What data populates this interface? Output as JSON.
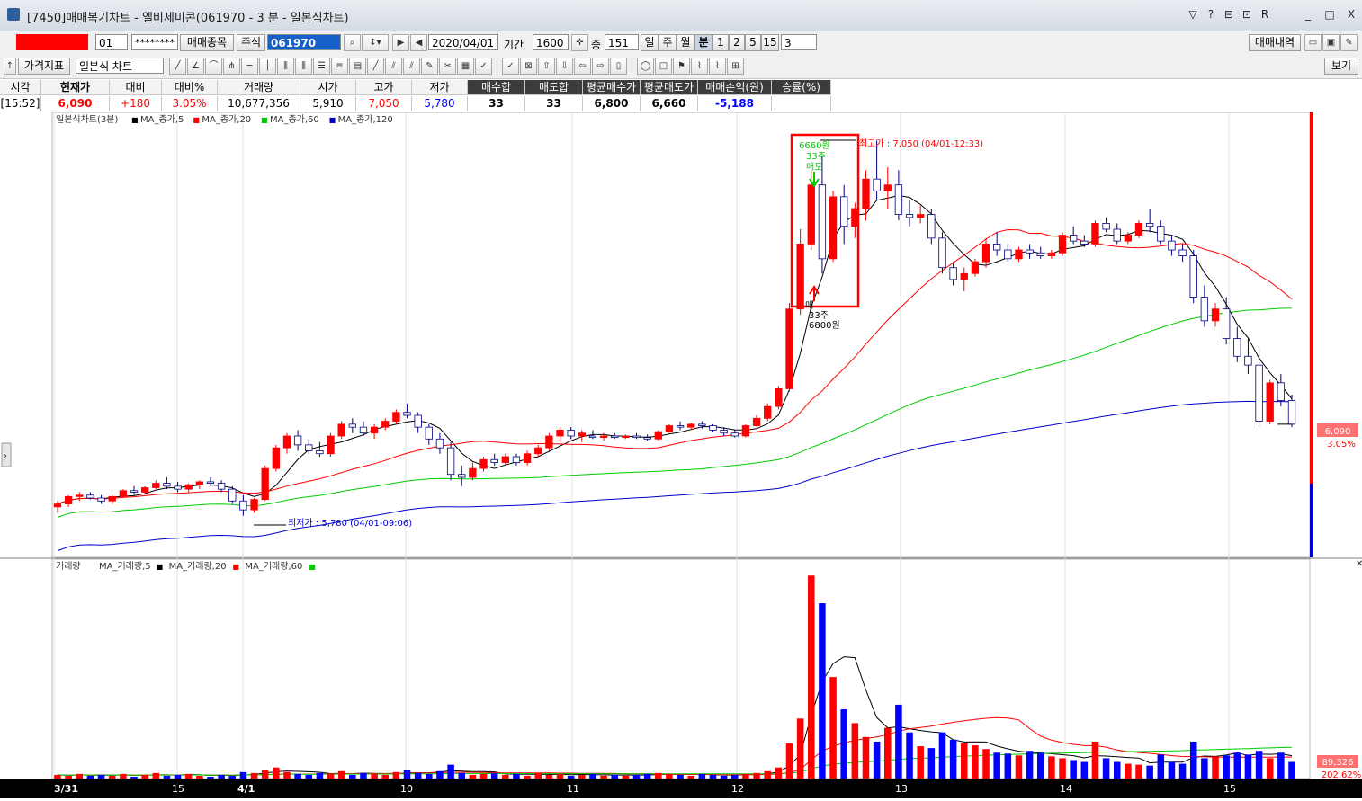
{
  "window": {
    "title": "[7450]매매복기차트 - 엘비세미콘(061970 - 3 분 - 일본식차트)",
    "controls": [
      "▽",
      "?",
      "⊟",
      "⊡",
      "R",
      "_",
      "□",
      "X"
    ]
  },
  "toolbar1": {
    "account_suffix": "01",
    "password": "********",
    "trade_items_btn": "매매종목",
    "market": "주식",
    "code": "061970",
    "date": "2020/04/01",
    "period_label": "기간",
    "period_value": "1600",
    "mid_label": "중",
    "count_value": "151",
    "units": [
      "일",
      "주",
      "월",
      "분",
      "1",
      "2",
      "5",
      "15",
      "3"
    ],
    "trade_history_btn": "매매내역"
  },
  "toolbar2": {
    "indicator_btn": "가격지표",
    "chart_type": "일본식 차트",
    "view_btn": "보기"
  },
  "quote": {
    "headers": [
      "시각",
      "현재가",
      "대비",
      "대비%",
      "거래량",
      "시가",
      "고가",
      "저가",
      "매수합",
      "매도합",
      "평균매수가",
      "평균매도가",
      "매매손익(원)",
      "승률(%)"
    ],
    "values": [
      "[15:52]",
      "6,090",
      "+180",
      "3.05%",
      "10,677,356",
      "5,910",
      "7,050",
      "5,780",
      "33",
      "33",
      "6,800",
      "6,660",
      "-5,188",
      ""
    ]
  },
  "chart_data": {
    "type": "candlestick",
    "price_legend": {
      "title": "일본식차트(3분)",
      "ma": [
        {
          "name": "MA_종가,5",
          "color": "#000000"
        },
        {
          "name": "MA_종가,20",
          "color": "#ff0000"
        },
        {
          "name": "MA_종가,60",
          "color": "#00cc00"
        },
        {
          "name": "MA_종가,120",
          "color": "#0000cc"
        }
      ]
    },
    "volume_legend": {
      "title": "거래량",
      "ma": [
        {
          "name": "MA_거래량,5",
          "color": "#000000"
        },
        {
          "name": "MA_거래량,20",
          "color": "#ff0000"
        },
        {
          "name": "MA_거래량,60",
          "color": "#00cc00"
        }
      ]
    },
    "x_ticks": [
      "3/31",
      "15",
      "4/1",
      "10",
      "11",
      "12",
      "13",
      "14",
      "15"
    ],
    "annotations": {
      "high": "최고가 : 7,050 (04/01-12:33)",
      "low": "최저가 : 5,780 (04/01-09:06)",
      "sell": [
        "6660원",
        "33주",
        "매도"
      ],
      "buy": [
        "매",
        "33주",
        "6800원"
      ]
    },
    "current_price": "6,090",
    "current_change": "3.05%",
    "volume_right_value": "89,326",
    "volume_right_pct": "202.62%",
    "y_range_price": [
      5700,
      7100
    ],
    "candles": [
      [
        5810,
        5830,
        5790,
        5820
      ],
      [
        5820,
        5850,
        5810,
        5845
      ],
      [
        5845,
        5860,
        5830,
        5850
      ],
      [
        5850,
        5860,
        5835,
        5840
      ],
      [
        5840,
        5850,
        5820,
        5830
      ],
      [
        5830,
        5850,
        5820,
        5845
      ],
      [
        5845,
        5870,
        5840,
        5865
      ],
      [
        5865,
        5880,
        5850,
        5860
      ],
      [
        5860,
        5880,
        5855,
        5875
      ],
      [
        5875,
        5900,
        5870,
        5890
      ],
      [
        5890,
        5910,
        5870,
        5880
      ],
      [
        5880,
        5895,
        5860,
        5870
      ],
      [
        5870,
        5890,
        5860,
        5885
      ],
      [
        5885,
        5900,
        5870,
        5895
      ],
      [
        5895,
        5910,
        5880,
        5890
      ],
      [
        5890,
        5900,
        5860,
        5870
      ],
      [
        5870,
        5880,
        5820,
        5830
      ],
      [
        5830,
        5850,
        5780,
        5800
      ],
      [
        5800,
        5840,
        5790,
        5835
      ],
      [
        5835,
        5950,
        5830,
        5940
      ],
      [
        5940,
        6020,
        5930,
        6010
      ],
      [
        6010,
        6060,
        5990,
        6050
      ],
      [
        6050,
        6070,
        6000,
        6020
      ],
      [
        6020,
        6040,
        5990,
        6000
      ],
      [
        6000,
        6030,
        5980,
        5990
      ],
      [
        5990,
        6060,
        5980,
        6050
      ],
      [
        6050,
        6100,
        6040,
        6090
      ],
      [
        6090,
        6110,
        6060,
        6080
      ],
      [
        6080,
        6100,
        6050,
        6060
      ],
      [
        6060,
        6090,
        6040,
        6080
      ],
      [
        6080,
        6110,
        6070,
        6100
      ],
      [
        6100,
        6140,
        6090,
        6130
      ],
      [
        6130,
        6160,
        6110,
        6120
      ],
      [
        6120,
        6130,
        6060,
        6080
      ],
      [
        6080,
        6090,
        6020,
        6040
      ],
      [
        6040,
        6060,
        5990,
        6010
      ],
      [
        6010,
        6030,
        5900,
        5920
      ],
      [
        5920,
        5950,
        5880,
        5910
      ],
      [
        5910,
        5960,
        5900,
        5940
      ],
      [
        5940,
        5980,
        5930,
        5970
      ],
      [
        5970,
        5990,
        5950,
        5960
      ],
      [
        5960,
        5990,
        5950,
        5980
      ],
      [
        5980,
        5990,
        5950,
        5960
      ],
      [
        5960,
        6000,
        5950,
        5990
      ],
      [
        5990,
        6020,
        5980,
        6010
      ],
      [
        6010,
        6060,
        6000,
        6050
      ],
      [
        6050,
        6080,
        6030,
        6070
      ],
      [
        6070,
        6080,
        6040,
        6050
      ],
      [
        6050,
        6070,
        6030,
        6060
      ],
      [
        6050,
        6070,
        6040,
        6045
      ],
      [
        6045,
        6060,
        6035,
        6050
      ],
      [
        6050,
        6060,
        6040,
        6045
      ],
      [
        6045,
        6055,
        6040,
        6050
      ],
      [
        6050,
        6060,
        6040,
        6045
      ],
      [
        6045,
        6055,
        6035,
        6040
      ],
      [
        6040,
        6070,
        6035,
        6065
      ],
      [
        6065,
        6090,
        6060,
        6085
      ],
      [
        6085,
        6100,
        6070,
        6080
      ],
      [
        6080,
        6095,
        6070,
        6090
      ],
      [
        6090,
        6100,
        6075,
        6085
      ],
      [
        6085,
        6090,
        6065,
        6070
      ],
      [
        6070,
        6080,
        6050,
        6060
      ],
      [
        6060,
        6070,
        6045,
        6050
      ],
      [
        6050,
        6090,
        6045,
        6085
      ],
      [
        6085,
        6120,
        6080,
        6110
      ],
      [
        6110,
        6160,
        6100,
        6150
      ],
      [
        6150,
        6220,
        6140,
        6210
      ],
      [
        6210,
        6500,
        6200,
        6480
      ],
      [
        6480,
        6750,
        6460,
        6700
      ],
      [
        6700,
        6950,
        6680,
        6900
      ],
      [
        6900,
        7000,
        6600,
        6650
      ],
      [
        6650,
        6880,
        6640,
        6860
      ],
      [
        6860,
        6900,
        6700,
        6760
      ],
      [
        6760,
        6840,
        6720,
        6820
      ],
      [
        6820,
        6950,
        6780,
        6920
      ],
      [
        6920,
        7050,
        6850,
        6880
      ],
      [
        6880,
        6960,
        6820,
        6900
      ],
      [
        6900,
        6950,
        6780,
        6800
      ],
      [
        6800,
        6850,
        6760,
        6790
      ],
      [
        6790,
        6830,
        6770,
        6800
      ],
      [
        6800,
        6820,
        6700,
        6720
      ],
      [
        6720,
        6740,
        6600,
        6620
      ],
      [
        6620,
        6640,
        6560,
        6580
      ],
      [
        6580,
        6620,
        6540,
        6600
      ],
      [
        6600,
        6650,
        6590,
        6640
      ],
      [
        6640,
        6720,
        6620,
        6700
      ],
      [
        6700,
        6740,
        6660,
        6680
      ],
      [
        6680,
        6700,
        6640,
        6650
      ],
      [
        6650,
        6690,
        6640,
        6680
      ],
      [
        6680,
        6700,
        6650,
        6670
      ],
      [
        6670,
        6690,
        6650,
        6660
      ],
      [
        6660,
        6680,
        6650,
        6670
      ],
      [
        6670,
        6740,
        6660,
        6730
      ],
      [
        6730,
        6760,
        6700,
        6710
      ],
      [
        6710,
        6730,
        6690,
        6700
      ],
      [
        6700,
        6780,
        6690,
        6770
      ],
      [
        6770,
        6790,
        6740,
        6750
      ],
      [
        6750,
        6770,
        6700,
        6710
      ],
      [
        6710,
        6740,
        6700,
        6730
      ],
      [
        6730,
        6780,
        6720,
        6770
      ],
      [
        6770,
        6820,
        6740,
        6760
      ],
      [
        6760,
        6780,
        6700,
        6710
      ],
      [
        6710,
        6730,
        6660,
        6680
      ],
      [
        6680,
        6700,
        6640,
        6660
      ],
      [
        6660,
        6680,
        6500,
        6520
      ],
      [
        6520,
        6560,
        6420,
        6440
      ],
      [
        6440,
        6500,
        6420,
        6480
      ],
      [
        6480,
        6520,
        6360,
        6380
      ],
      [
        6380,
        6420,
        6300,
        6320
      ],
      [
        6320,
        6380,
        6260,
        6290
      ],
      [
        6290,
        6350,
        6080,
        6100
      ],
      [
        6100,
        6240,
        6090,
        6230
      ],
      [
        6230,
        6260,
        6150,
        6170
      ],
      [
        6170,
        6190,
        6080,
        6090
      ]
    ],
    "volumes": [
      4,
      3,
      5,
      3,
      4,
      3,
      5,
      2,
      4,
      6,
      3,
      4,
      5,
      3,
      2,
      4,
      3,
      7,
      6,
      9,
      12,
      7,
      5,
      4,
      6,
      5,
      8,
      4,
      6,
      5,
      4,
      7,
      9,
      6,
      5,
      8,
      15,
      6,
      4,
      5,
      6,
      4,
      5,
      3,
      6,
      4,
      5,
      3,
      4,
      5,
      3,
      4,
      3,
      4,
      5,
      6,
      5,
      4,
      3,
      5,
      4,
      3,
      4,
      5,
      6,
      8,
      12,
      38,
      65,
      220,
      190,
      110,
      75,
      60,
      45,
      40,
      55,
      80,
      50,
      35,
      33,
      50,
      42,
      38,
      36,
      32,
      28,
      27,
      25,
      30,
      28,
      24,
      22,
      20,
      18,
      40,
      22,
      18,
      16,
      15,
      14,
      26,
      18,
      16,
      40,
      22,
      24,
      25,
      28,
      26,
      30,
      22,
      28,
      18,
      32
    ],
    "volume_colors": "alternating-red-blue",
    "y_range_volume": [
      0,
      230
    ]
  }
}
